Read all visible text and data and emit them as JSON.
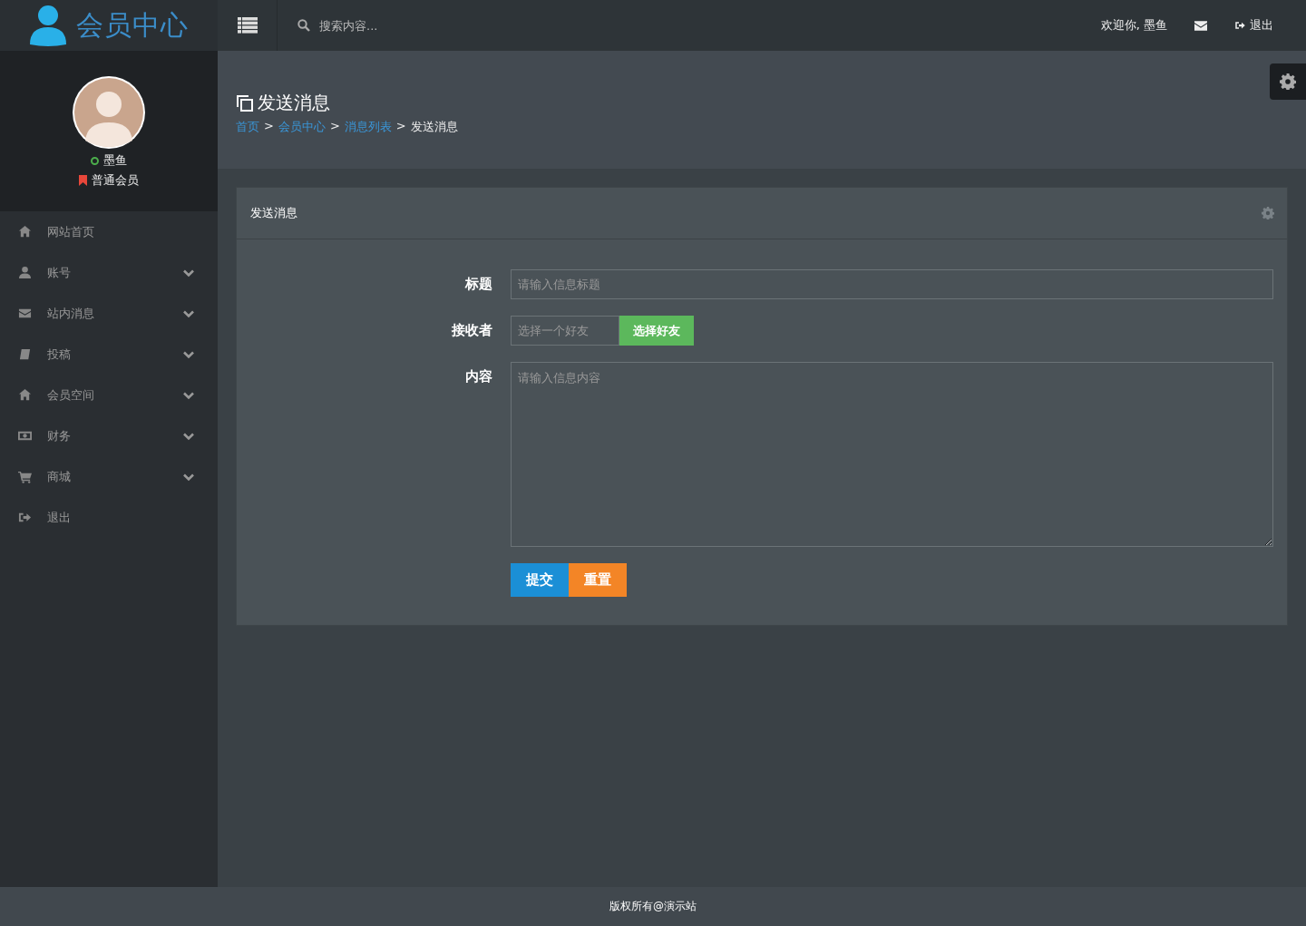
{
  "header": {
    "logo": "会员中心",
    "search": {
      "placeholder": "搜索内容..."
    },
    "welcome": "欢迎你, 墨鱼",
    "logout": "退出"
  },
  "profile": {
    "name": "墨鱼",
    "online": true,
    "level": "普通会员"
  },
  "sidebar": {
    "items": [
      {
        "label": "网站首页",
        "has_submenu": false
      },
      {
        "label": "账号",
        "has_submenu": true
      },
      {
        "label": "站内消息",
        "has_submenu": true
      },
      {
        "label": "投稿",
        "has_submenu": true
      },
      {
        "label": "会员空间",
        "has_submenu": true
      },
      {
        "label": "财务",
        "has_submenu": true
      },
      {
        "label": "商城",
        "has_submenu": true
      },
      {
        "label": "退出",
        "has_submenu": false
      }
    ]
  },
  "page": {
    "title": "发送消息",
    "breadcrumb": [
      {
        "kind": "link",
        "label": "首页"
      },
      {
        "kind": "separator",
        "label": ">"
      },
      {
        "kind": "link",
        "label": "会员中心"
      },
      {
        "kind": "separator",
        "label": ">"
      },
      {
        "kind": "link",
        "label": "消息列表"
      },
      {
        "kind": "separator",
        "label": ">"
      },
      {
        "kind": "current",
        "label": "发送消息"
      }
    ]
  },
  "panel": {
    "title": "发送消息",
    "fields": [
      {
        "kind": "text",
        "label": "标题",
        "placeholder": "请输入信息标题"
      },
      {
        "kind": "picker",
        "label": "接收者",
        "placeholder": "选择一个好友",
        "button": "选择好友"
      },
      {
        "kind": "textarea",
        "label": "内容",
        "placeholder": "请输入信息内容"
      }
    ],
    "buttons": [
      {
        "label": "提交",
        "kind": "primary"
      },
      {
        "label": "重置",
        "kind": "warning"
      }
    ]
  },
  "footer": "版权所有@演示站"
}
